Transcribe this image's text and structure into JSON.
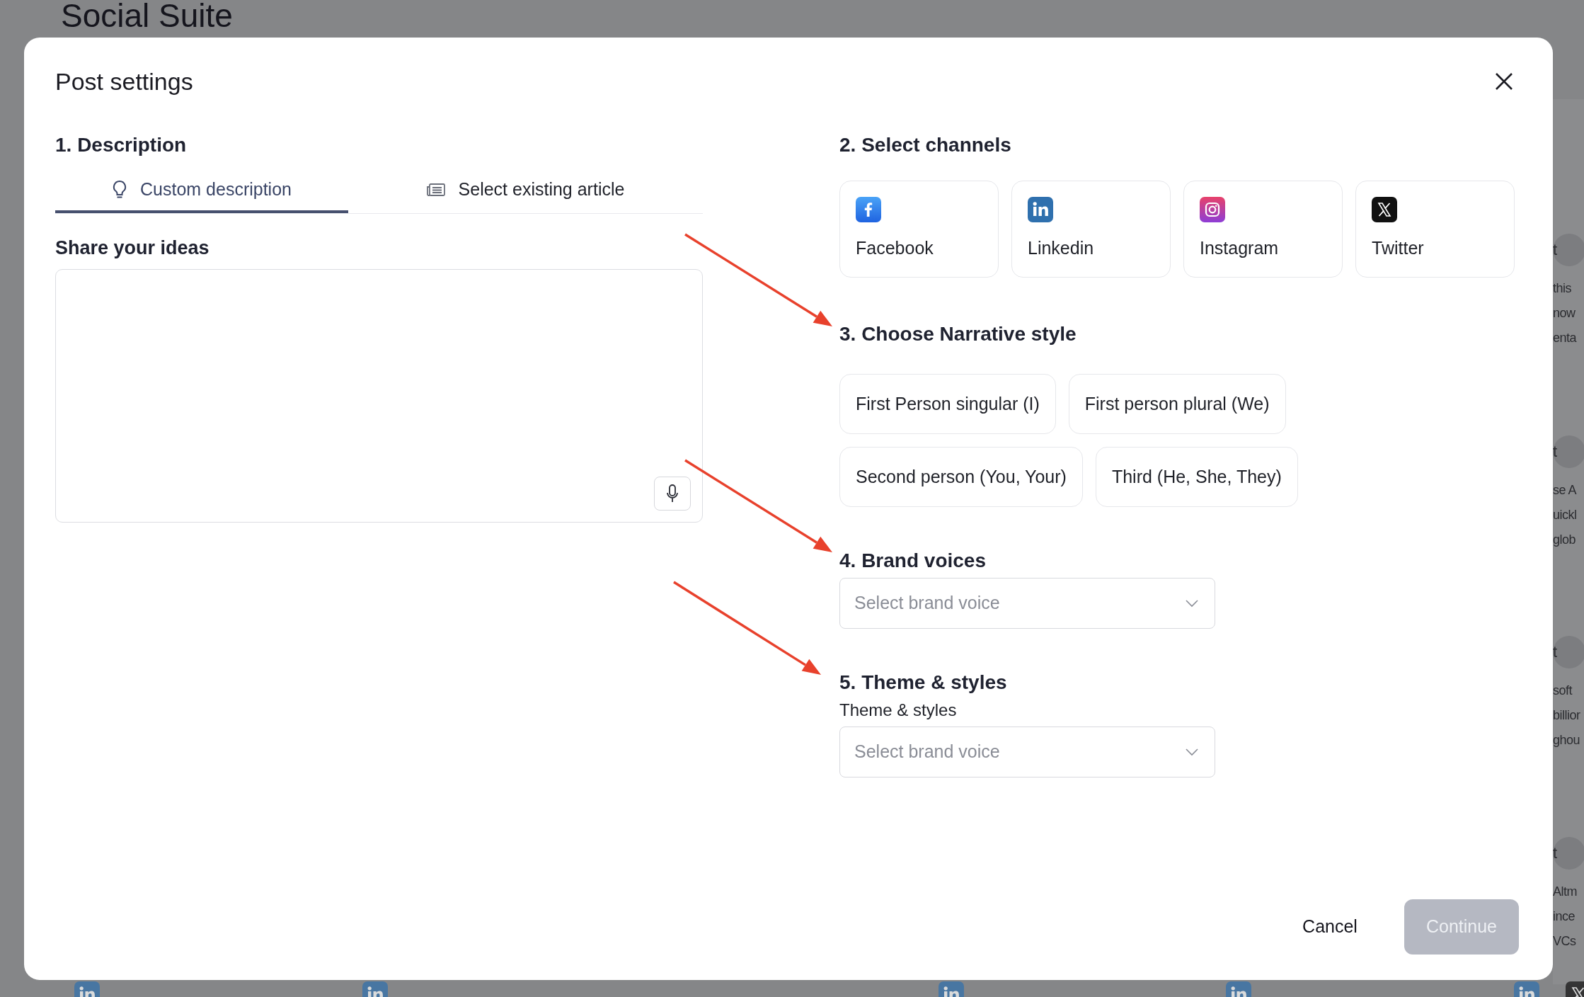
{
  "page_title": "Social Suite",
  "background_fragments": [
    {
      "badge": "t",
      "lines": [
        "this",
        "now",
        "enta"
      ]
    },
    {
      "badge": "t",
      "lines": [
        "se A",
        "uickl",
        "glob"
      ]
    },
    {
      "badge": "t",
      "lines": [
        "soft",
        "billior",
        "ghou"
      ]
    },
    {
      "badge": "t",
      "lines": [
        "Altm",
        "ince",
        "VCs"
      ]
    }
  ],
  "background_icons": [
    {
      "kind": "linkedin"
    },
    {
      "kind": "linkedin"
    },
    {
      "kind": "linkedin"
    },
    {
      "kind": "linkedin"
    },
    {
      "kind": "linkedin"
    },
    {
      "kind": "x"
    }
  ],
  "dialog": {
    "title": "Post settings",
    "description": {
      "heading": "1. Description",
      "tabs": [
        {
          "label": "Custom description",
          "kind": "bulb",
          "selected": true
        },
        {
          "label": "Select existing article",
          "kind": "article",
          "selected": false
        }
      ],
      "ideas_label": "Share your ideas"
    },
    "channels": {
      "heading": "2. Select channels",
      "items": [
        {
          "label": "Facebook",
          "kind": "facebook"
        },
        {
          "label": "Linkedin",
          "kind": "linkedin"
        },
        {
          "label": "Instagram",
          "kind": "instagram"
        },
        {
          "label": "Twitter",
          "kind": "x"
        }
      ]
    },
    "narrative": {
      "heading": "3. Choose Narrative style",
      "rows": [
        [
          "First Person singular (I)",
          "First person plural (We)"
        ],
        [
          "Second person (You, Your)",
          "Third (He, She, They)"
        ]
      ]
    },
    "brand_voices": {
      "heading": "4. Brand voices",
      "placeholder": "Select brand voice"
    },
    "theme": {
      "heading": "5. Theme & styles",
      "label": "Theme & styles",
      "placeholder": "Select brand voice"
    },
    "buttons": [
      {
        "label": "Cancel",
        "kind": "secondary",
        "disabled": false
      },
      {
        "label": "Continue",
        "kind": "primary",
        "disabled": true
      }
    ]
  }
}
